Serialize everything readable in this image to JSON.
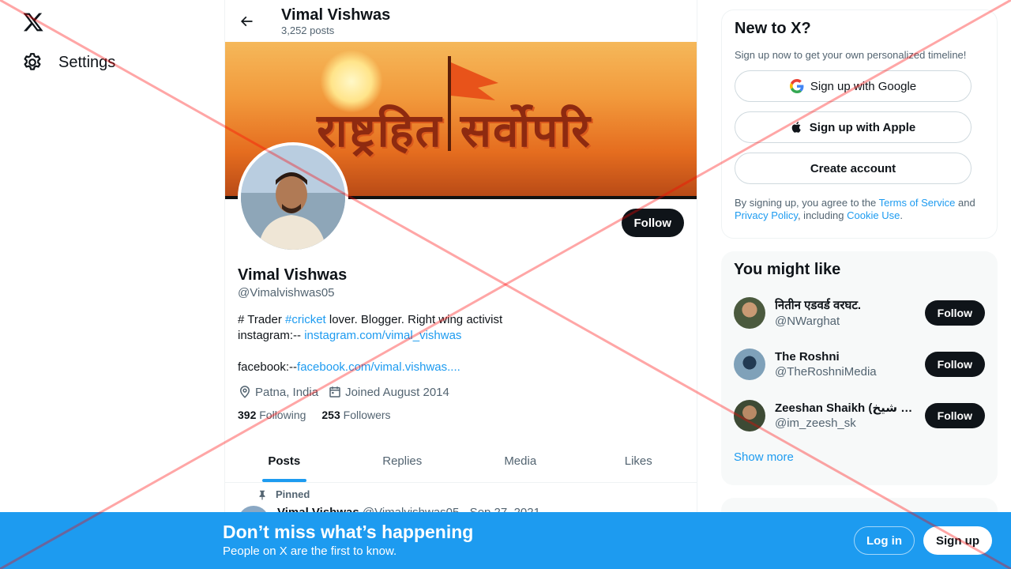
{
  "nav": {
    "settings_label": "Settings"
  },
  "header": {
    "name": "Vimal Vishwas",
    "post_count": "3,252 posts"
  },
  "banner": {
    "text": "राष्ट्रहित सर्वोपरि"
  },
  "profile": {
    "follow_label": "Follow",
    "name": "Vimal Vishwas",
    "handle": "@Vimalvishwas05",
    "bio_prefix": "# Trader ",
    "bio_hashtag": "#cricket",
    "bio_mid": " lover.  Blogger. Right wing activist",
    "bio_line2_prefix": "instagram:-- ",
    "bio_instagram": "instagram.com/vimal_vishwas",
    "bio_line3_prefix": "facebook:--",
    "bio_facebook": "facebook.com/vimal.vishwas....",
    "location": "Patna, India",
    "joined": "Joined August 2014",
    "following_count": "392",
    "following_label": "Following",
    "followers_count": "253",
    "followers_label": "Followers"
  },
  "tabs": [
    {
      "label": "Posts",
      "active": true
    },
    {
      "label": "Replies",
      "active": false
    },
    {
      "label": "Media",
      "active": false
    },
    {
      "label": "Likes",
      "active": false
    }
  ],
  "post": {
    "pinned_label": "Pinned",
    "author": "Vimal Vishwas",
    "handle_date": "@Vimalvishwas05 · Sep 27, 2021"
  },
  "newx": {
    "title": "New to X?",
    "subtitle": "Sign up now to get your own personalized timeline!",
    "google_label": "Sign up with Google",
    "apple_label": "Sign up with Apple",
    "create_label": "Create account",
    "legal_prefix": "By signing up, you agree to the ",
    "terms": "Terms of Service",
    "and": " and ",
    "privacy": "Privacy Policy",
    "including": ", including ",
    "cookie": "Cookie Use",
    "period": "."
  },
  "might_like": {
    "title": "You might like",
    "suggestions": [
      {
        "name": "नितीन एडवर्ड वरघट.",
        "handle": "@NWarghat",
        "follow": "Follow"
      },
      {
        "name": "The Roshni",
        "handle": "@TheRoshniMedia",
        "follow": "Follow"
      },
      {
        "name": "Zeeshan Shaikh (ذیشان شیخ",
        "handle": "@im_zeesh_sk",
        "follow": "Follow"
      }
    ],
    "show_more": "Show more"
  },
  "bottom_bar": {
    "title": "Don’t miss what’s happening",
    "subtitle": "People on X are the first to know.",
    "login_label": "Log in",
    "signup_label": "Sign up"
  },
  "colors": {
    "accent": "#1d9bf0",
    "text": "#0f1419",
    "muted": "#536471",
    "overlay_x": "#ff0000"
  }
}
